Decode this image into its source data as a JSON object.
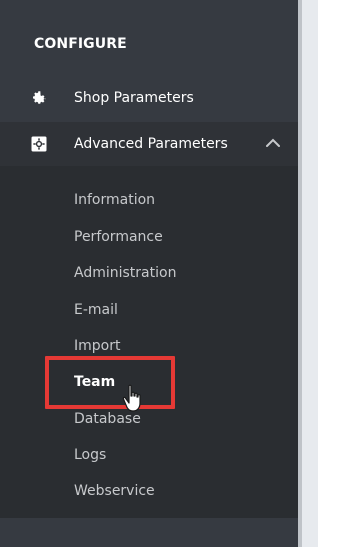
{
  "sidebar": {
    "section_title": "CONFIGURE",
    "items": [
      {
        "label": "Shop Parameters",
        "icon": "gear-icon"
      },
      {
        "label": "Advanced Parameters",
        "icon": "settings-box-icon",
        "expanded": true
      }
    ],
    "submenu": [
      "Information",
      "Performance",
      "Administration",
      "E-mail",
      "Import",
      "Team",
      "Database",
      "Logs",
      "Webservice"
    ],
    "active_submenu": "Team"
  },
  "colors": {
    "sidebar_bg": "#363a41",
    "submenu_bg": "#2a2d31",
    "highlight": "#e53935",
    "text": "#ffffff"
  }
}
